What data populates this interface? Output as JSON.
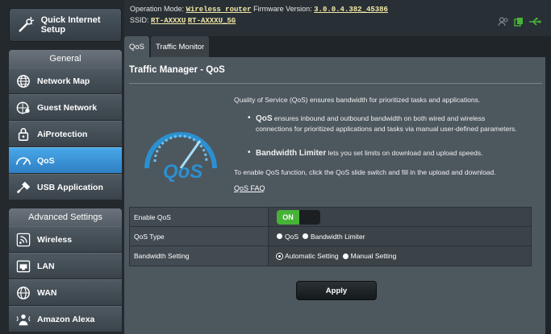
{
  "sidebar": {
    "quick_setup": "Quick Internet Setup",
    "general_heading": "General",
    "general_items": [
      {
        "label": "Network Map"
      },
      {
        "label": "Guest Network"
      },
      {
        "label": "AiProtection"
      },
      {
        "label": "QoS"
      },
      {
        "label": "USB Application"
      }
    ],
    "advanced_heading": "Advanced Settings",
    "advanced_items": [
      {
        "label": "Wireless"
      },
      {
        "label": "LAN"
      },
      {
        "label": "WAN"
      },
      {
        "label": "Amazon Alexa"
      }
    ],
    "active_item": "QoS"
  },
  "header": {
    "op_mode_label": "Operation Mode:",
    "op_mode_value": "Wireless router",
    "firmware_label": "Firmware Version:",
    "firmware_value": "3.0.0.4.382_45386",
    "ssid_label": "SSID:",
    "ssid_1": "RT-AXXXU",
    "ssid_2": "RT-AXXXU_5G",
    "icons": [
      "users-icon",
      "copy-icon",
      "usb-icon"
    ]
  },
  "tabs": [
    {
      "label": "QoS",
      "active": true
    },
    {
      "label": "Traffic Monitor",
      "active": false
    }
  ],
  "main": {
    "title": "Traffic Manager - QoS",
    "intro": "Quality of Service (QoS) ensures bandwidth for prioritized tasks and applications.",
    "bullet1_bold": "QoS",
    "bullet1_text": " ensures inbound and outbound bandwidth on both wired and wireless connections for prioritized applications and tasks via manual user-defined parameters.",
    "bullet2_bold": "Bandwidth Limiter",
    "bullet2_text": " lets you set limits on download and upload speeds.",
    "enable_note": "To enable QoS function, click the QoS slide switch and fill in the upload and download.",
    "faq_link": "QoS FAQ",
    "logo_text": "QoS"
  },
  "settings": {
    "enable_label": "Enable QoS",
    "enable_state": "ON",
    "type_label": "QoS Type",
    "type_options": [
      "QoS",
      "Bandwidth Limiter"
    ],
    "bandwidth_label": "Bandwidth Setting",
    "bandwidth_options": [
      "Automatic Setting",
      "Manual Setting"
    ],
    "apply_label": "Apply"
  },
  "colors": {
    "active_nav": "#3a94d8",
    "toggle_on": "#46b337",
    "panel": "#4d575e"
  }
}
